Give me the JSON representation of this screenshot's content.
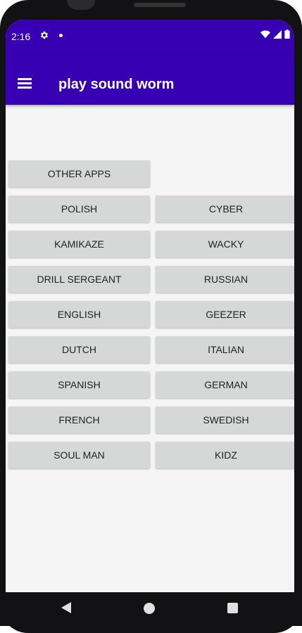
{
  "status_bar": {
    "time": "2:16",
    "icons": [
      "gear-icon",
      "notification-dot-icon",
      "wifi-icon",
      "signal-icon",
      "battery-icon"
    ]
  },
  "app_bar": {
    "title": "play sound worm",
    "menu_icon": "hamburger-menu-icon"
  },
  "buttons": {
    "other_apps": "OTHER APPS",
    "polish": "POLISH",
    "cyber": "CYBER",
    "kamikaze": "KAMIKAZE",
    "wacky": "WACKY",
    "drill_sergeant": "DRILL SERGEANT",
    "russian": "RUSSIAN",
    "english": "ENGLISH",
    "geezer": "GEEZER",
    "dutch": "DUTCH",
    "italian": "ITALIAN",
    "spanish": "SPANISH",
    "german": "GERMAN",
    "french": "FRENCH",
    "swedish": "SWEDISH",
    "soul_man": "SOUL MAN",
    "kidz": "KIDZ"
  },
  "nav_bar": {
    "icons": [
      "back-icon",
      "home-icon",
      "recents-icon"
    ]
  },
  "colors": {
    "app_bar": "#3700b3",
    "button_bg": "#d6d7d7",
    "screen_bg": "#f5f5f5"
  }
}
